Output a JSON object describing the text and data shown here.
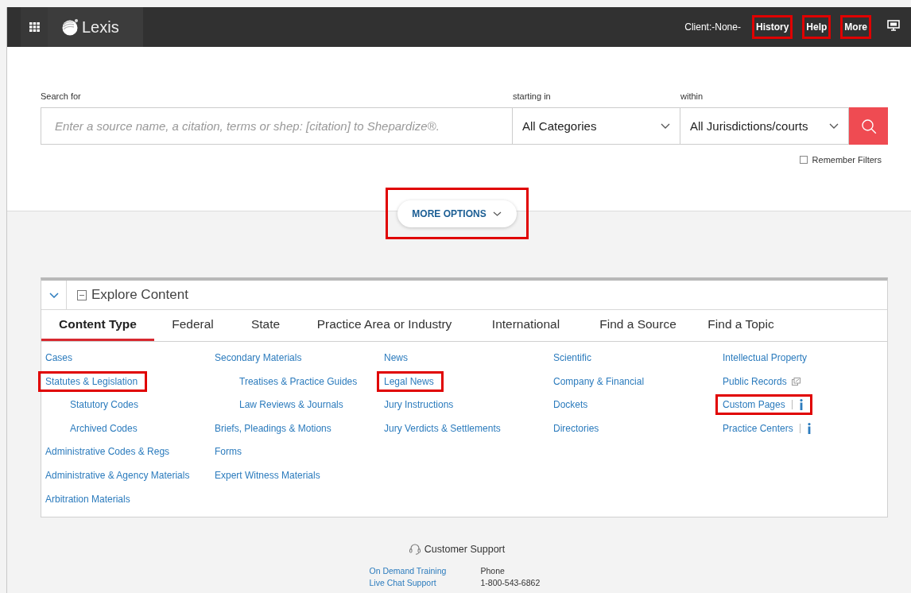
{
  "topbar": {
    "logo": "Lexis",
    "client": "Client:-None-",
    "nav": [
      {
        "label": "History",
        "highlighted": true
      },
      {
        "label": "Help",
        "highlighted": true
      },
      {
        "label": "More",
        "highlighted": true
      }
    ]
  },
  "search": {
    "search_label": "Search for",
    "placeholder": "Enter a source name, a citation, terms or shep: [citation] to Shepardize®.",
    "category_label": "starting in",
    "category": "All Categories",
    "jurisdiction_label": "within",
    "jurisdiction": "All Jurisdictions/courts",
    "remember_filters": {
      "label": "Remember Filters",
      "checked": false
    }
  },
  "more_options": {
    "label": "MORE OPTIONS",
    "highlighted": true
  },
  "explore": {
    "title": "Explore Content",
    "expanded": true,
    "tabs": [
      {
        "label": "Content Type",
        "selected": true
      },
      {
        "label": "Federal",
        "selected": false
      },
      {
        "label": "State",
        "selected": false
      },
      {
        "label": "Practice Area or Industry",
        "selected": false
      },
      {
        "label": "International",
        "selected": false
      },
      {
        "label": "Find a Source",
        "selected": false
      },
      {
        "label": "Find a Topic",
        "selected": false
      }
    ],
    "columns": [
      [
        {
          "label": "Cases",
          "highlighted": false
        },
        {
          "label": "Statutes & Legislation",
          "highlighted": true,
          "children": [
            {
              "label": "Statutory Codes",
              "highlighted": false
            },
            {
              "label": "Archived Codes",
              "highlighted": false
            }
          ]
        },
        {
          "label": "Administrative Codes & Regs",
          "highlighted": false
        },
        {
          "label": "Administrative & Agency Materials",
          "highlighted": false
        },
        {
          "label": "Arbitration Materials",
          "highlighted": false
        }
      ],
      [
        {
          "label": "Secondary Materials",
          "highlighted": false,
          "children": [
            {
              "label": "Treatises & Practice Guides",
              "highlighted": false
            },
            {
              "label": "Law Reviews & Journals",
              "highlighted": false
            }
          ]
        },
        {
          "label": "Briefs, Pleadings & Motions",
          "highlighted": false
        },
        {
          "label": "Forms",
          "highlighted": false
        },
        {
          "label": "Expert Witness Materials",
          "highlighted": false
        }
      ],
      [
        {
          "label": "News",
          "highlighted": false
        },
        {
          "label": "Legal News",
          "highlighted": true
        },
        {
          "label": "Jury Instructions",
          "highlighted": false
        },
        {
          "label": "Jury Verdicts & Settlements",
          "highlighted": false
        }
      ],
      [
        {
          "label": "Scientific",
          "highlighted": false
        },
        {
          "label": "Company & Financial",
          "highlighted": false
        },
        {
          "label": "Dockets",
          "highlighted": false
        },
        {
          "label": "Directories",
          "highlighted": false
        }
      ],
      [
        {
          "label": "Intellectual Property",
          "highlighted": false
        },
        {
          "label": "Public Records",
          "kind": "external",
          "highlighted": false
        },
        {
          "label": "Custom Pages",
          "kind": "info",
          "highlighted": true
        },
        {
          "label": "Practice Centers",
          "kind": "info",
          "highlighted": false
        }
      ]
    ]
  },
  "footer": {
    "title": "Customer Support",
    "links": [
      "On Demand Training",
      "Live Chat Support"
    ],
    "phone_label": "Phone",
    "phone": "1-800-543-6862"
  }
}
